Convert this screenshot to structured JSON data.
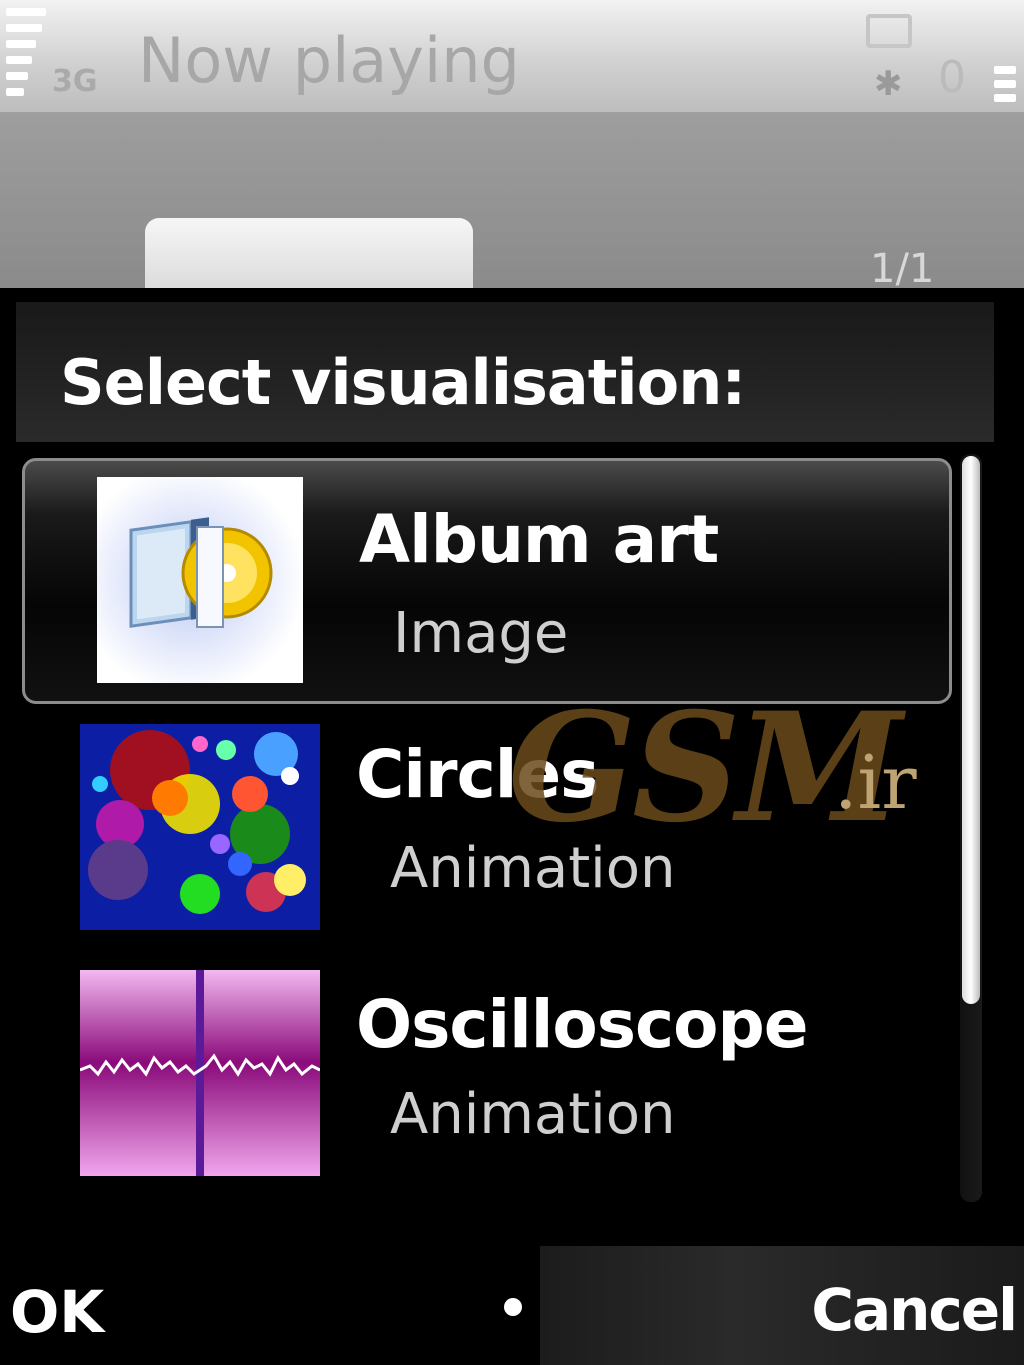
{
  "status_bar": {
    "network": "3G",
    "title": "Now playing",
    "count": "0"
  },
  "player": {
    "track_position": "1/1"
  },
  "dialog": {
    "title": "Select visualisation:",
    "items": [
      {
        "title": "Album art",
        "subtitle": "Image",
        "selected": true,
        "icon": "album-art-icon"
      },
      {
        "title": "Circles",
        "subtitle": "Animation",
        "selected": false,
        "icon": "circles-icon"
      },
      {
        "title": "Oscilloscope",
        "subtitle": "Animation",
        "selected": false,
        "icon": "oscilloscope-icon"
      }
    ]
  },
  "softkeys": {
    "left": "OK",
    "right": "Cancel"
  },
  "watermark": {
    "text": "GSM",
    "suffix": ".ir"
  },
  "colors": {
    "selection_border": "#8c8c8c",
    "scrollbar": "#ffffff",
    "watermark": "#6b4a1b"
  }
}
